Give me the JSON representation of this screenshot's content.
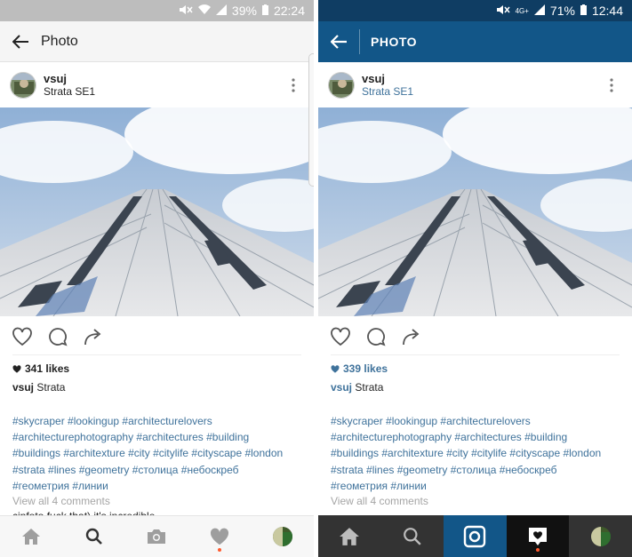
{
  "left": {
    "status": {
      "mute": "½",
      "battery_pct": "39%",
      "time": "22:24"
    },
    "appbar": {
      "title": "Photo"
    },
    "post": {
      "username": "vsuj",
      "location": "Strata SE1",
      "likes": "341 likes",
      "caption_user": "vsuj",
      "caption_text": "Strata",
      "hashtag_lines": [
        "#skycraper #lookingup #architecturelovers",
        "#architecturephotography #architectures #building",
        "#buildings #architexture  #city #citylife #cityscape #london",
        "#strata #lines #geometry #столица #небоскреб",
        "#геометрия #линии"
      ],
      "view_comments": "View all 4 comments",
      "cut_comment": "cinfoto fuck that) it's incredible"
    }
  },
  "right": {
    "status": {
      "network": "4G+",
      "battery_pct": "71%",
      "time": "12:44"
    },
    "appbar": {
      "title": "PHOTO"
    },
    "post": {
      "username": "vsuj",
      "location": "Strata SE1",
      "likes": "339 likes",
      "caption_user": "vsuj",
      "caption_text": "Strata",
      "hashtag_lines": [
        "#skycraper #lookingup #architecturelovers",
        "#architecturephotography #architectures #building",
        "#buildings #architexture #city #citylife #cityscape #london",
        "#strata #lines #geometry #столица #небоскреб",
        "#геометрия #линии"
      ],
      "view_comments": "View all 4 comments"
    }
  },
  "colors": {
    "instagram_blue": "#125688",
    "status_dark_blue": "#0f3d63",
    "link_blue": "#3f729b",
    "notification_orange": "#ff5a2e"
  },
  "icons": {
    "left_appbar": "back-arrow-icon",
    "actions": [
      "heart-icon",
      "comment-icon",
      "share-icon"
    ],
    "bottom_nav": [
      "home-icon",
      "search-icon",
      "camera-icon",
      "activity-heart-icon",
      "profile-avatar"
    ]
  }
}
